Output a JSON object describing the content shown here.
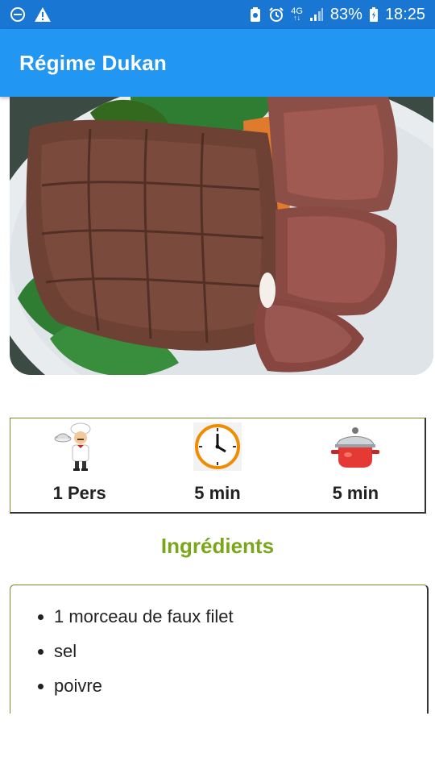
{
  "status_bar": {
    "battery": "83%",
    "time": "18:25",
    "network": "4G",
    "icons": [
      "do-not-disturb-icon",
      "warning-icon",
      "battery-saver-icon",
      "alarm-icon",
      "network-4g-icon",
      "signal-icon",
      "battery-icon"
    ]
  },
  "app_bar": {
    "title": "Régime Dukan"
  },
  "hero": {
    "icon": "roast-beef-photo"
  },
  "info": {
    "servings": {
      "value": "1 Pers",
      "icon": "chef-icon"
    },
    "prep_time": {
      "value": "5 min",
      "icon": "clock-icon"
    },
    "cook_time": {
      "value": "5 min",
      "icon": "cooking-pot-icon"
    }
  },
  "ingredients": {
    "title": "Ingrédients",
    "items": [
      "1 morceau de faux filet",
      "sel",
      "poivre"
    ]
  },
  "colors": {
    "status_bar": "#1976d2",
    "app_bar": "#2196f3",
    "section_title": "#7aa61a",
    "card_border": "#7b8a2a"
  }
}
